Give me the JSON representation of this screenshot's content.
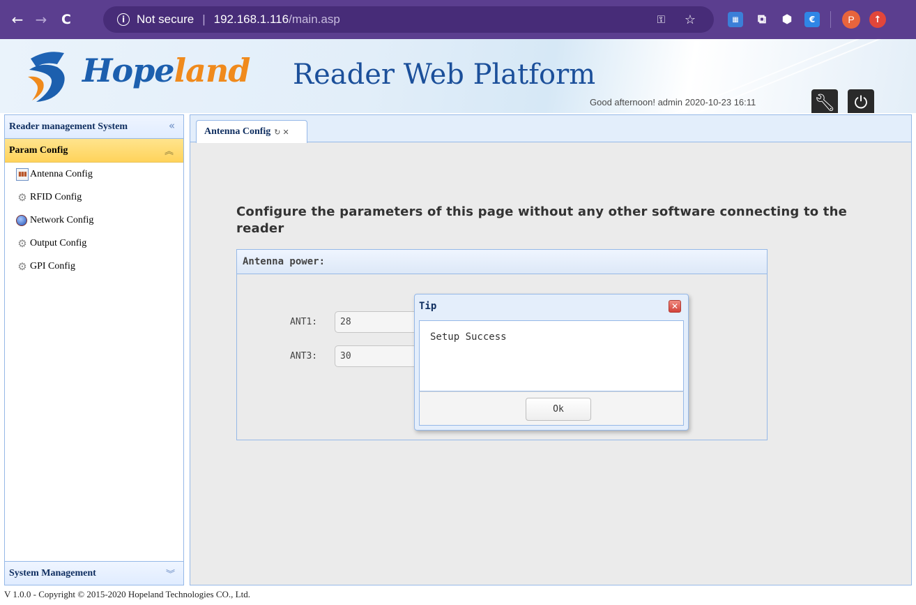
{
  "browser": {
    "not_secure": "Not secure",
    "url_host": "192.168.1.116",
    "url_path": "/main.asp",
    "profile_initial": "P"
  },
  "header": {
    "logo_part1": "Hope",
    "logo_part2": "land",
    "title": "Reader Web Platform",
    "greeting": "Good afternoon! admin   2020-10-23 16:11"
  },
  "sidebar": {
    "title": "Reader management System",
    "section": "Param Config",
    "items": [
      {
        "label": "Antenna Config",
        "icon": "antenna-icon"
      },
      {
        "label": "RFID Config",
        "icon": "gear-icon"
      },
      {
        "label": "Network Config",
        "icon": "globe-icon"
      },
      {
        "label": "Output Config",
        "icon": "gear-icon"
      },
      {
        "label": "GPI Config",
        "icon": "gear-icon"
      }
    ],
    "bottom_section": "System Management"
  },
  "tabs": [
    {
      "label": "Antenna Config"
    }
  ],
  "content": {
    "notice": "Configure the parameters of this page without any other software connecting to the reader",
    "fieldset_title": "Antenna power:",
    "antennas": [
      {
        "label": "ANT1:",
        "value": "28"
      },
      {
        "label": "ANT3:",
        "value": "30"
      }
    ]
  },
  "dialog": {
    "title": "Tip",
    "message": "Setup Success",
    "ok_label": "Ok"
  },
  "footer": {
    "copyright": "V 1.0.0 - Copyright © 2015-2020 Hopeland Technologies CO., Ltd."
  },
  "colors": {
    "browser_frame": "#5b3e8f",
    "panel_border": "#95b8e7",
    "section_highlight": "#ffd35b",
    "brand_blue": "#1c5fae",
    "brand_orange": "#f08a1c"
  }
}
